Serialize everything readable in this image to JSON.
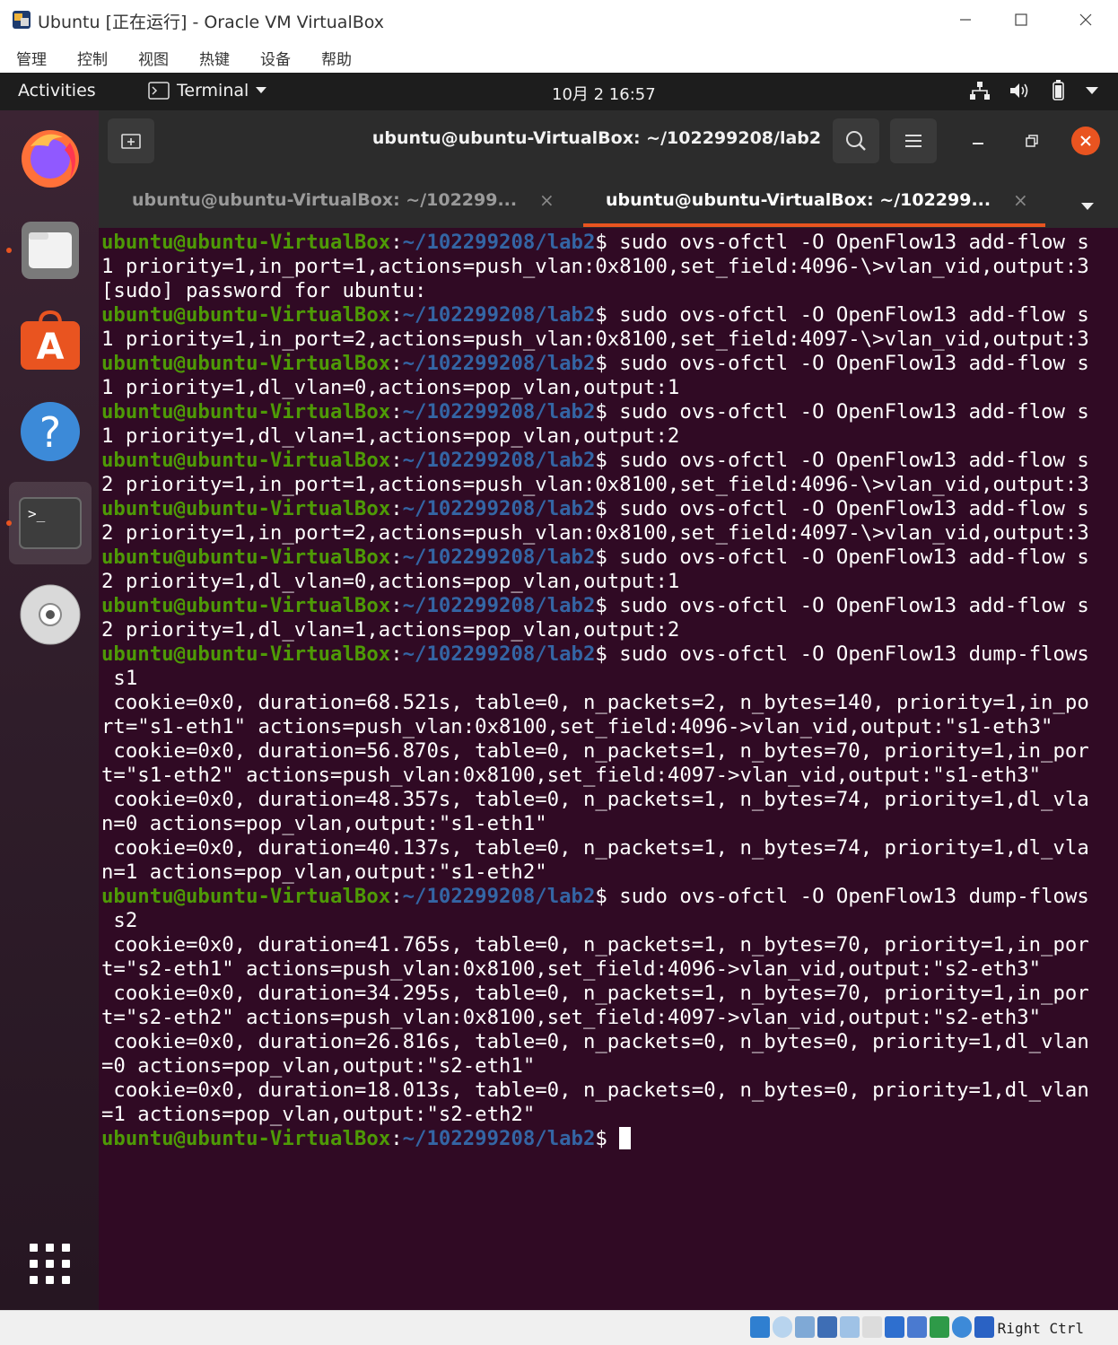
{
  "vbox": {
    "window_title": "Ubuntu [正在运行] - Oracle VM VirtualBox",
    "menu": [
      "管理",
      "控制",
      "视图",
      "热键",
      "设备",
      "帮助"
    ],
    "host_key": "Right Ctrl"
  },
  "topbar": {
    "activities": "Activities",
    "app_name": "Terminal",
    "clock": "10月 2  16:57"
  },
  "dock": {
    "items": [
      "firefox",
      "files",
      "ubuntu-software",
      "help",
      "terminal",
      "dvd"
    ]
  },
  "terminal": {
    "window_title": "ubuntu@ubuntu-VirtualBox: ~/102299208/lab2",
    "tabs": [
      {
        "label": "ubuntu@ubuntu-VirtualBox: ~/102299...",
        "active": false
      },
      {
        "label": "ubuntu@ubuntu-VirtualBox: ~/102299...",
        "active": true
      }
    ],
    "prompt_user": "ubuntu@ubuntu-VirtualBox",
    "prompt_path": "~/102299208/lab2",
    "lines": [
      {
        "prompt": true,
        "text": " sudo ovs-ofctl -O OpenFlow13 add-flow s"
      },
      {
        "prompt": false,
        "text": "1 priority=1,in_port=1,actions=push_vlan:0x8100,set_field:4096-\\>vlan_vid,output:3"
      },
      {
        "prompt": false,
        "text": "[sudo] password for ubuntu:"
      },
      {
        "prompt": true,
        "text": " sudo ovs-ofctl -O OpenFlow13 add-flow s"
      },
      {
        "prompt": false,
        "text": "1 priority=1,in_port=2,actions=push_vlan:0x8100,set_field:4097-\\>vlan_vid,output:3"
      },
      {
        "prompt": true,
        "text": " sudo ovs-ofctl -O OpenFlow13 add-flow s"
      },
      {
        "prompt": false,
        "text": "1 priority=1,dl_vlan=0,actions=pop_vlan,output:1"
      },
      {
        "prompt": true,
        "text": " sudo ovs-ofctl -O OpenFlow13 add-flow s"
      },
      {
        "prompt": false,
        "text": "1 priority=1,dl_vlan=1,actions=pop_vlan,output:2"
      },
      {
        "prompt": true,
        "text": " sudo ovs-ofctl -O OpenFlow13 add-flow s"
      },
      {
        "prompt": false,
        "text": "2 priority=1,in_port=1,actions=push_vlan:0x8100,set_field:4096-\\>vlan_vid,output:3"
      },
      {
        "prompt": true,
        "text": " sudo ovs-ofctl -O OpenFlow13 add-flow s"
      },
      {
        "prompt": false,
        "text": "2 priority=1,in_port=2,actions=push_vlan:0x8100,set_field:4097-\\>vlan_vid,output:3"
      },
      {
        "prompt": true,
        "text": " sudo ovs-ofctl -O OpenFlow13 add-flow s"
      },
      {
        "prompt": false,
        "text": "2 priority=1,dl_vlan=0,actions=pop_vlan,output:1"
      },
      {
        "prompt": true,
        "text": " sudo ovs-ofctl -O OpenFlow13 add-flow s"
      },
      {
        "prompt": false,
        "text": "2 priority=1,dl_vlan=1,actions=pop_vlan,output:2"
      },
      {
        "prompt": true,
        "text": " sudo ovs-ofctl -O OpenFlow13 dump-flows"
      },
      {
        "prompt": false,
        "text": " s1"
      },
      {
        "prompt": false,
        "text": " cookie=0x0, duration=68.521s, table=0, n_packets=2, n_bytes=140, priority=1,in_po"
      },
      {
        "prompt": false,
        "text": "rt=\"s1-eth1\" actions=push_vlan:0x8100,set_field:4096->vlan_vid,output:\"s1-eth3\""
      },
      {
        "prompt": false,
        "text": " cookie=0x0, duration=56.870s, table=0, n_packets=1, n_bytes=70, priority=1,in_por"
      },
      {
        "prompt": false,
        "text": "t=\"s1-eth2\" actions=push_vlan:0x8100,set_field:4097->vlan_vid,output:\"s1-eth3\""
      },
      {
        "prompt": false,
        "text": " cookie=0x0, duration=48.357s, table=0, n_packets=1, n_bytes=74, priority=1,dl_vla"
      },
      {
        "prompt": false,
        "text": "n=0 actions=pop_vlan,output:\"s1-eth1\""
      },
      {
        "prompt": false,
        "text": " cookie=0x0, duration=40.137s, table=0, n_packets=1, n_bytes=74, priority=1,dl_vla"
      },
      {
        "prompt": false,
        "text": "n=1 actions=pop_vlan,output:\"s1-eth2\""
      },
      {
        "prompt": true,
        "text": " sudo ovs-ofctl -O OpenFlow13 dump-flows"
      },
      {
        "prompt": false,
        "text": " s2"
      },
      {
        "prompt": false,
        "text": " cookie=0x0, duration=41.765s, table=0, n_packets=1, n_bytes=70, priority=1,in_por"
      },
      {
        "prompt": false,
        "text": "t=\"s2-eth1\" actions=push_vlan:0x8100,set_field:4096->vlan_vid,output:\"s2-eth3\""
      },
      {
        "prompt": false,
        "text": " cookie=0x0, duration=34.295s, table=0, n_packets=1, n_bytes=70, priority=1,in_por"
      },
      {
        "prompt": false,
        "text": "t=\"s2-eth2\" actions=push_vlan:0x8100,set_field:4097->vlan_vid,output:\"s2-eth3\""
      },
      {
        "prompt": false,
        "text": " cookie=0x0, duration=26.816s, table=0, n_packets=0, n_bytes=0, priority=1,dl_vlan"
      },
      {
        "prompt": false,
        "text": "=0 actions=pop_vlan,output:\"s2-eth1\""
      },
      {
        "prompt": false,
        "text": " cookie=0x0, duration=18.013s, table=0, n_packets=0, n_bytes=0, priority=1,dl_vlan"
      },
      {
        "prompt": false,
        "text": "=1 actions=pop_vlan,output:\"s2-eth2\""
      },
      {
        "prompt": true,
        "text": " ",
        "cursor": true
      }
    ]
  },
  "colors": {
    "terminal_bg": "#300a24",
    "prompt_user": "#4e9a06",
    "prompt_path": "#3465a4",
    "accent": "#e95420"
  }
}
